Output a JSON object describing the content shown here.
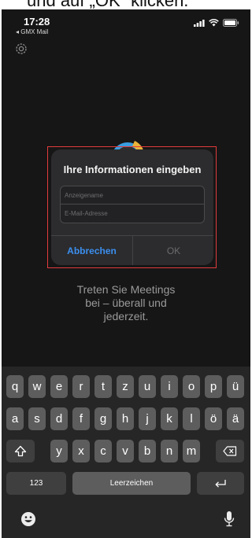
{
  "caption": {
    "text": "und auf „OK“ klicken."
  },
  "status_bar": {
    "time": "17:28",
    "back_app": "◂ GMX Mail"
  },
  "dialog": {
    "title": "Ihre Informationen eingeben",
    "display_name_placeholder": "Anzeigename",
    "email_placeholder": "E-Mail-Adresse",
    "cancel_label": "Abbrechen",
    "ok_label": "OK"
  },
  "tagline": {
    "line1": "Treten Sie Meetings",
    "line2": "bei – überall und",
    "line3": "jederzeit."
  },
  "keyboard": {
    "row1": [
      "q",
      "w",
      "e",
      "r",
      "t",
      "z",
      "u",
      "i",
      "o",
      "p",
      "ü"
    ],
    "row2": [
      "a",
      "s",
      "d",
      "f",
      "g",
      "h",
      "j",
      "k",
      "l",
      "ö",
      "ä"
    ],
    "row3": [
      "y",
      "x",
      "c",
      "v",
      "b",
      "n",
      "m"
    ],
    "numbers_label": "123",
    "space_label": "Leerzeichen"
  },
  "colors": {
    "accent": "#3b8fef",
    "highlight_outline": "#e23b3b"
  }
}
